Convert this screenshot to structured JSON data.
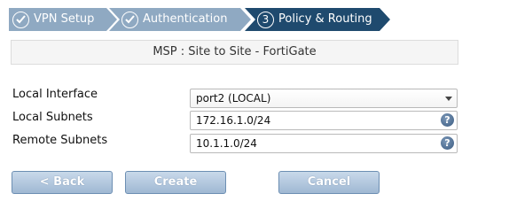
{
  "wizard": {
    "steps": [
      {
        "label": "VPN Setup",
        "state": "done",
        "badge": "check"
      },
      {
        "label": "Authentication",
        "state": "done",
        "badge": "check"
      },
      {
        "label": "Policy & Routing",
        "state": "current",
        "badge": "3"
      }
    ],
    "colors": {
      "done": "#8fa9c2",
      "current": "#1f4a6e"
    }
  },
  "title": "MSP : Site to Site - FortiGate",
  "form": {
    "local_interface": {
      "label": "Local Interface",
      "value": "port2 (LOCAL)"
    },
    "local_subnets": {
      "label": "Local Subnets",
      "value": "172.16.1.0/24"
    },
    "remote_subnets": {
      "label": "Remote Subnets",
      "value": "10.1.1.0/24"
    },
    "help_icon": "?"
  },
  "buttons": {
    "back": "< Back",
    "create": "Create",
    "cancel": "Cancel"
  }
}
